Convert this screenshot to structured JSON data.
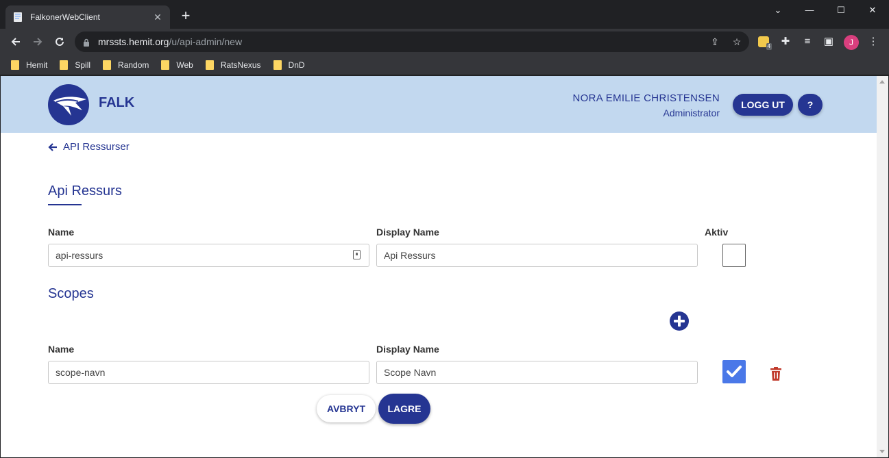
{
  "browser": {
    "tab_title": "FalkonerWebClient",
    "url_host": "mrssts.hemit.org",
    "url_path": "/u/api-admin/new",
    "extension_badge": "4",
    "profile_initial": "J",
    "bookmarks": [
      {
        "label": "Hemit"
      },
      {
        "label": "Spill"
      },
      {
        "label": "Random"
      },
      {
        "label": "Web"
      },
      {
        "label": "RatsNexus"
      },
      {
        "label": "DnD"
      }
    ]
  },
  "header": {
    "brand": "FALK",
    "user_name": "NORA EMILIE CHRISTENSEN",
    "user_role": "Administrator",
    "logout_label": "LOGG UT",
    "help_label": "?"
  },
  "page": {
    "back_label": "API Ressurser",
    "title": "Api Ressurs",
    "resource": {
      "name_label": "Name",
      "name_value": "api-ressurs",
      "display_name_label": "Display Name",
      "display_name_value": "Api Ressurs",
      "active_label": "Aktiv",
      "active": false
    },
    "scopes_title": "Scopes",
    "scope": {
      "name_label": "Name",
      "name_value": "scope-navn",
      "display_name_label": "Display Name",
      "display_name_value": "Scope Navn",
      "active": true
    },
    "cancel_label": "AVBRYT",
    "save_label": "LAGRE"
  },
  "colors": {
    "primary": "#253592",
    "header_bg": "#c2d8ef",
    "checkbox_checked": "#4a78e8",
    "trash": "#c0392b"
  },
  "icons": [
    "back-icon",
    "forward-icon",
    "reload-icon",
    "lock-icon",
    "share-icon",
    "star-icon",
    "extensions-icon",
    "media-icon",
    "sidepanel-icon",
    "menu-icon",
    "arrow-left-icon",
    "plus-circle-icon",
    "check-icon",
    "trash-icon",
    "key-icon"
  ]
}
